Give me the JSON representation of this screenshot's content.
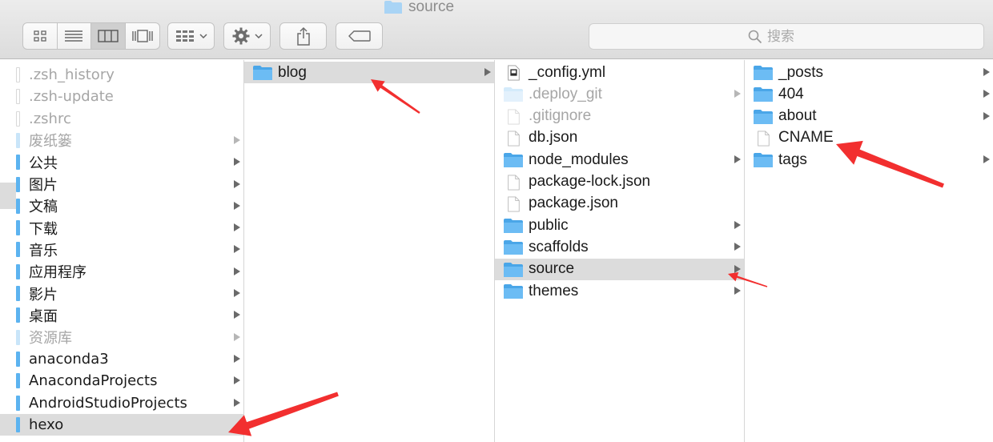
{
  "window": {
    "title": "source",
    "title_icon": "folder-icon"
  },
  "toolbar": {
    "view_buttons": [
      {
        "name": "icon-view",
        "icon": "grid-icon"
      },
      {
        "name": "list-view",
        "icon": "list-icon"
      },
      {
        "name": "column-view",
        "icon": "columns-icon",
        "active": true
      },
      {
        "name": "cover-flow-view",
        "icon": "cover-flow-icon"
      }
    ],
    "arrange_icon": "arrange-grid-icon",
    "action_icon": "gear-icon",
    "share_icon": "share-icon",
    "tag_icon": "tag-icon",
    "search": {
      "placeholder": "搜索",
      "value": "",
      "icon": "search-icon"
    }
  },
  "columns": [
    {
      "items": [
        {
          "name": ".zsh_history",
          "dim": true,
          "kind": "doc"
        },
        {
          "name": ".zsh-update",
          "dim": true,
          "kind": "doc"
        },
        {
          "name": ".zshrc",
          "dim": true,
          "kind": "doc"
        },
        {
          "name": "废纸篓",
          "dim": true,
          "kind": "folder",
          "arrow": true
        },
        {
          "name": "公共",
          "kind": "folder",
          "arrow": true
        },
        {
          "name": "图片",
          "kind": "folder",
          "arrow": true
        },
        {
          "name": "文稿",
          "kind": "folder",
          "arrow": true
        },
        {
          "name": "下载",
          "kind": "folder",
          "arrow": true
        },
        {
          "name": "音乐",
          "kind": "folder",
          "arrow": true
        },
        {
          "name": "应用程序",
          "kind": "folder",
          "arrow": true
        },
        {
          "name": "影片",
          "kind": "folder",
          "arrow": true
        },
        {
          "name": "桌面",
          "kind": "folder",
          "arrow": true
        },
        {
          "name": "资源库",
          "dim": true,
          "kind": "folder",
          "arrow": true
        },
        {
          "name": "anaconda3",
          "kind": "folder",
          "arrow": true
        },
        {
          "name": "AnacondaProjects",
          "kind": "folder",
          "arrow": true
        },
        {
          "name": "AndroidStudioProjects",
          "kind": "folder",
          "arrow": true
        },
        {
          "name": "hexo",
          "kind": "folder",
          "selected": true
        }
      ]
    },
    {
      "items": [
        {
          "name": "blog",
          "kind": "folder",
          "arrow": true,
          "selected": true
        }
      ]
    },
    {
      "items": [
        {
          "name": "_config.yml",
          "kind": "yml"
        },
        {
          "name": ".deploy_git",
          "kind": "folder",
          "dim": true,
          "arrow": true
        },
        {
          "name": ".gitignore",
          "kind": "doc",
          "dim": true
        },
        {
          "name": "db.json",
          "kind": "doc"
        },
        {
          "name": "node_modules",
          "kind": "folder",
          "arrow": true
        },
        {
          "name": "package-lock.json",
          "kind": "doc"
        },
        {
          "name": "package.json",
          "kind": "doc"
        },
        {
          "name": "public",
          "kind": "folder",
          "arrow": true
        },
        {
          "name": "scaffolds",
          "kind": "folder",
          "arrow": true
        },
        {
          "name": "source",
          "kind": "folder",
          "arrow": true,
          "selected": true
        },
        {
          "name": "themes",
          "kind": "folder",
          "arrow": true
        }
      ]
    },
    {
      "items": [
        {
          "name": "_posts",
          "kind": "folder",
          "arrow": true
        },
        {
          "name": "404",
          "kind": "folder",
          "arrow": true
        },
        {
          "name": "about",
          "kind": "folder",
          "arrow": true
        },
        {
          "name": "CNAME",
          "kind": "doc"
        },
        {
          "name": "tags",
          "kind": "folder",
          "arrow": true
        }
      ]
    }
  ],
  "annotation_color": "#f22f2f"
}
